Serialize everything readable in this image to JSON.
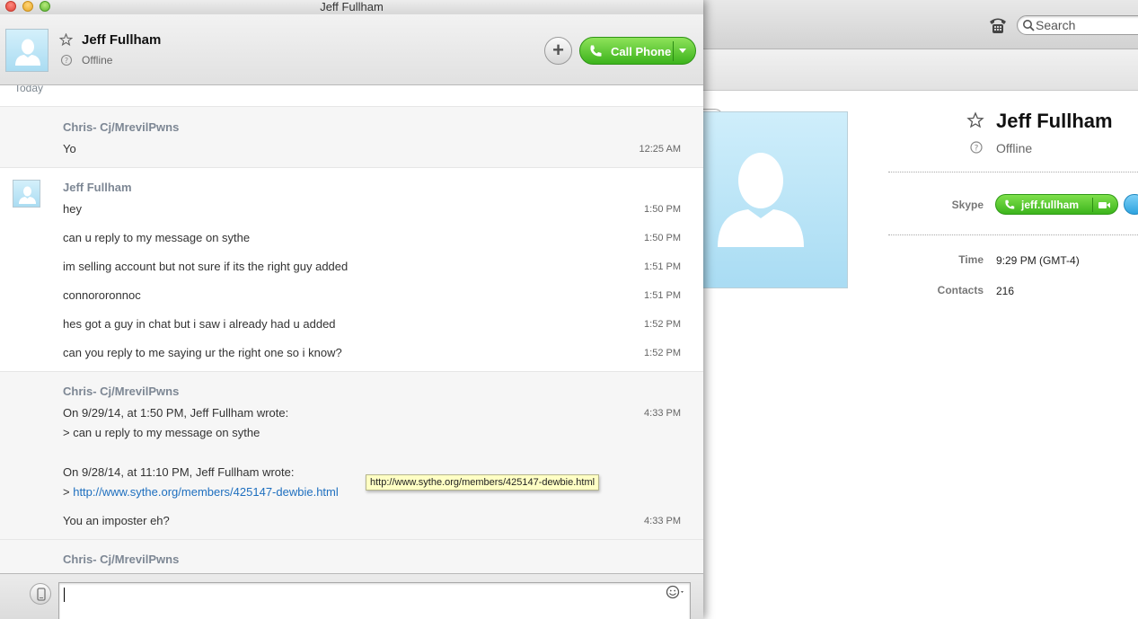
{
  "main_window": {
    "title_partial": "...",
    "search": {
      "placeholder": "Search",
      "value": ""
    },
    "profile": {
      "name": "Jeff Fullham",
      "status": "Offline",
      "skype_label": "Skype",
      "skype_name": "jeff.fullham",
      "time_label": "Time",
      "time_value": "9:29 PM (GMT-4)",
      "contacts_label": "Contacts",
      "contacts_value": "216"
    }
  },
  "chat_window": {
    "title": "Jeff Fullham",
    "header": {
      "name": "Jeff Fullham",
      "status": "Offline",
      "call_label": "Call Phone"
    },
    "today_label": "Today",
    "messages": [
      {
        "sender": "Chris- Cj/MrevilPwns",
        "lines": [
          {
            "text": "Yo",
            "time": "12:25 AM"
          }
        ]
      },
      {
        "sender": "Jeff Fullham",
        "lines": [
          {
            "text": "hey",
            "time": "1:50 PM"
          },
          {
            "text": "can u reply to my message on sythe",
            "time": "1:50 PM"
          },
          {
            "text": "im selling account but not sure if its the right guy added",
            "time": "1:51 PM"
          },
          {
            "text": "connororonnoc",
            "time": "1:51 PM"
          },
          {
            "text": "hes got a guy in chat but i saw i already had u added",
            "time": "1:52 PM"
          },
          {
            "text": "can you reply to me saying ur the right one so i know?",
            "time": "1:52 PM"
          }
        ]
      },
      {
        "sender": "Chris- Cj/MrevilPwns",
        "lines": [
          {
            "text": "On 9/29/14, at 1:50 PM, Jeff Fullham wrote:",
            "time": "4:33 PM"
          },
          {
            "text": "> can u reply to my message on sythe",
            "time": ""
          },
          {
            "text": "On 9/28/14, at 11:10 PM, Jeff Fullham wrote:",
            "time": ""
          },
          {
            "prefix": "> ",
            "link": "http://www.sythe.org/members/425147-dewbie.html",
            "time": ""
          },
          {
            "text": "You an imposter eh?",
            "time": "4:33 PM"
          }
        ]
      },
      {
        "sender": "Chris- Cj/MrevilPwns",
        "lines": []
      }
    ],
    "tooltip": "http://www.sythe.org/members/425147-dewbie.html",
    "compose": {
      "value": "",
      "placeholder": ""
    }
  },
  "colors": {
    "call_green": "#3cb31c",
    "link_blue": "#1e6fbf",
    "sender_gray": "#7d8794",
    "avatar_blue": "#aadcf2"
  }
}
